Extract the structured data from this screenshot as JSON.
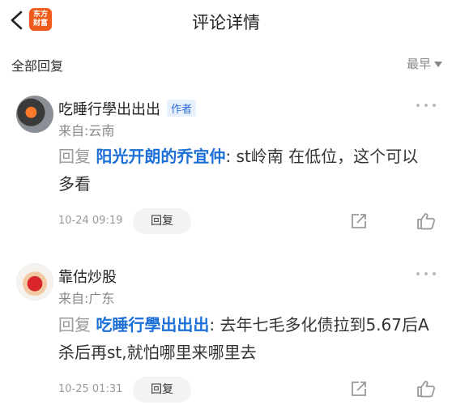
{
  "header": {
    "title": "评论详情",
    "logo_top": "东方",
    "logo_bottom": "财富"
  },
  "subbar": {
    "all_replies": "全部回复",
    "sort": "最早"
  },
  "comments": [
    {
      "name": "吃睡行學出出出",
      "tag": "作者",
      "source": "来自:云南",
      "reply_word": "回复",
      "mention": "阳光开朗的乔宜仲",
      "text": ": st岭南 在低位，这个可以多看",
      "time": "10-24 09:19",
      "reply_button": "回复"
    },
    {
      "name": "靠估炒股",
      "source": "来自:广东",
      "reply_word": "回复",
      "mention": "吃睡行學出出出",
      "text": ": 去年七毛多化债拉到5.67后A杀后再st,就怕哪里来哪里去",
      "time": "10-25 01:31",
      "reply_button": "回复"
    }
  ],
  "icons": {
    "back": "chevron-left-icon",
    "more": "more-dots-icon",
    "share": "share-icon",
    "like": "thumbs-up-icon"
  },
  "colors": {
    "mention": "#1d6fd8",
    "logo": "#f05a1a"
  }
}
